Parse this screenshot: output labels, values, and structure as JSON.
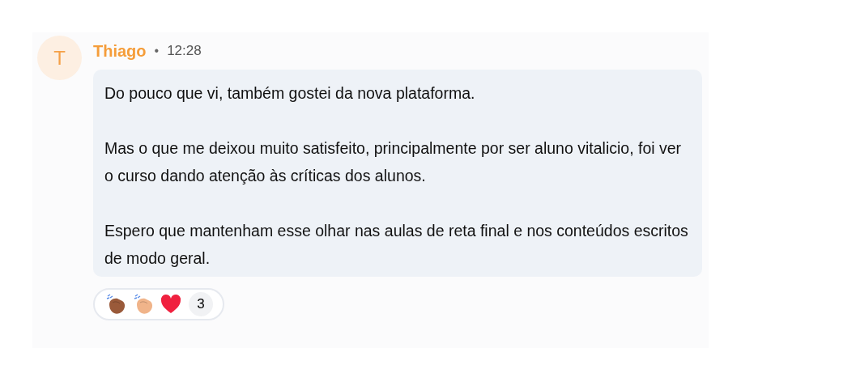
{
  "message": {
    "avatar_letter": "T",
    "author": "Thiago",
    "separator": "•",
    "time": "12:28",
    "paragraphs": [
      "Do pouco que vi, também gostei da nova plataforma.",
      "Mas o que me deixou muito satisfeito, principalmente por ser aluno vitalicio, foi ver o curso dando atenção às críticas dos alunos.",
      "Espero que mantenham esse olhar nas aulas de reta final e nos conteúdos escritos de modo geral."
    ],
    "reactions": [
      {
        "kind": "clap",
        "color": "#9a5a3a"
      },
      {
        "kind": "clap",
        "color": "#f0b48a"
      },
      {
        "kind": "heart"
      }
    ],
    "reaction_count": "3"
  }
}
